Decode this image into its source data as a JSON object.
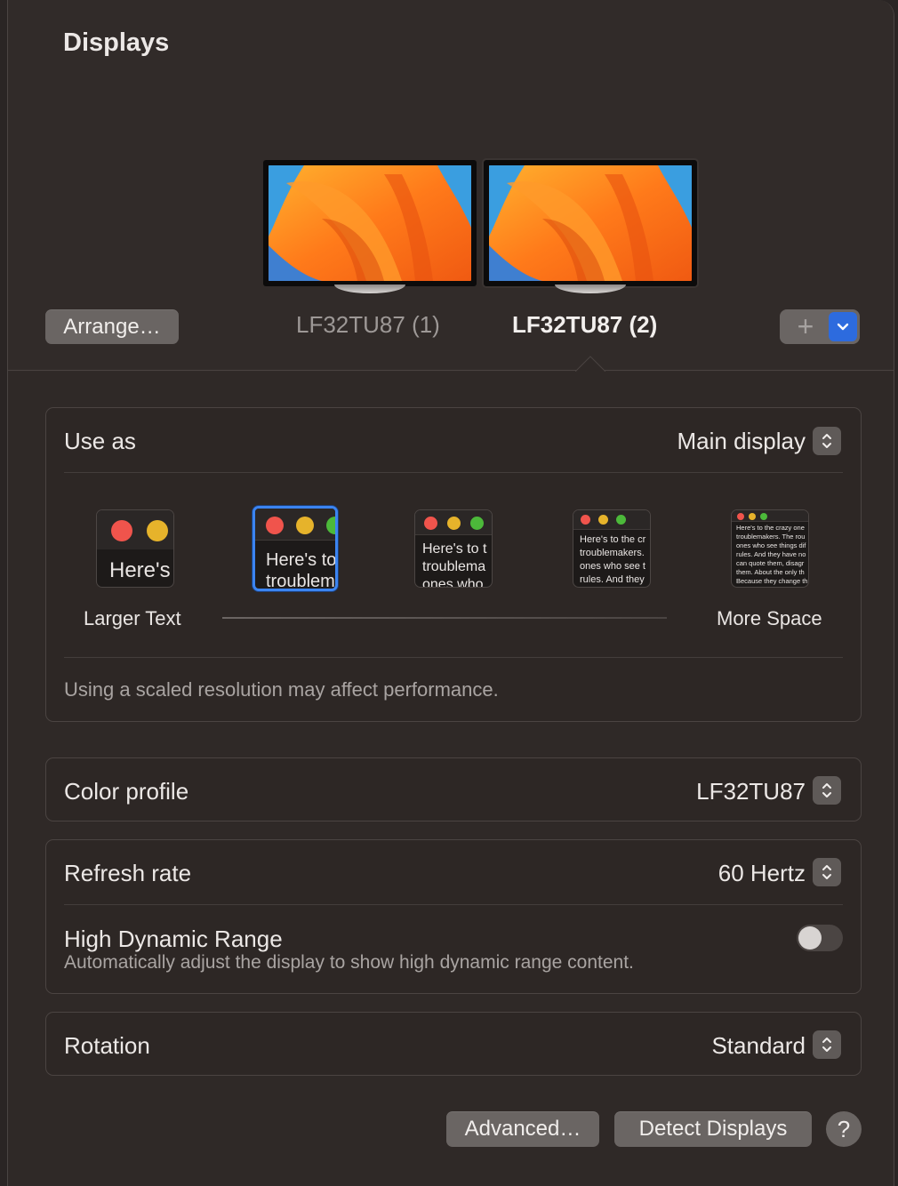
{
  "window": {
    "title": "Displays"
  },
  "monitors": [
    {
      "name": "LF32TU87 (1)",
      "selected": false
    },
    {
      "name": "LF32TU87 (2)",
      "selected": true
    }
  ],
  "toolbar": {
    "arrange_label": "Arrange…",
    "add_label": "+",
    "accent": "#2d6bde"
  },
  "use_as": {
    "label": "Use as",
    "value": "Main display"
  },
  "resolution": {
    "thumbnails": [
      {
        "text_lines": [
          "Here's"
        ]
      },
      {
        "text_lines": [
          "Here's to",
          "troublem"
        ]
      },
      {
        "text_lines": [
          "Here's to t",
          "troublema",
          "ones who"
        ]
      },
      {
        "text_lines": [
          "Here's to the cr",
          "troublemakers.",
          "ones who see t",
          "rules. And they"
        ]
      },
      {
        "text_lines": [
          "Here's to the crazy one",
          "troublemakers. The rou",
          "ones who see things dif",
          "rules. And they have no",
          "can quote them, disagr",
          "them. About the only th",
          "Because they change th"
        ]
      }
    ],
    "selected_index": 1,
    "larger_text_label": "Larger Text",
    "more_space_label": "More Space",
    "note": "Using a scaled resolution may affect performance."
  },
  "color_profile": {
    "label": "Color profile",
    "value": "LF32TU87"
  },
  "refresh_rate": {
    "label": "Refresh rate",
    "value": "60 Hertz"
  },
  "hdr": {
    "label": "High Dynamic Range",
    "description": "Automatically adjust the display to show high dynamic range content.",
    "enabled": false
  },
  "rotation": {
    "label": "Rotation",
    "value": "Standard"
  },
  "footer": {
    "advanced_label": "Advanced…",
    "detect_label": "Detect Displays",
    "help_label": "?"
  },
  "colors": {
    "traffic_red": "#f0544c",
    "traffic_yellow": "#e6b32b",
    "traffic_green": "#4cb93a",
    "selection": "#3b84f1"
  }
}
